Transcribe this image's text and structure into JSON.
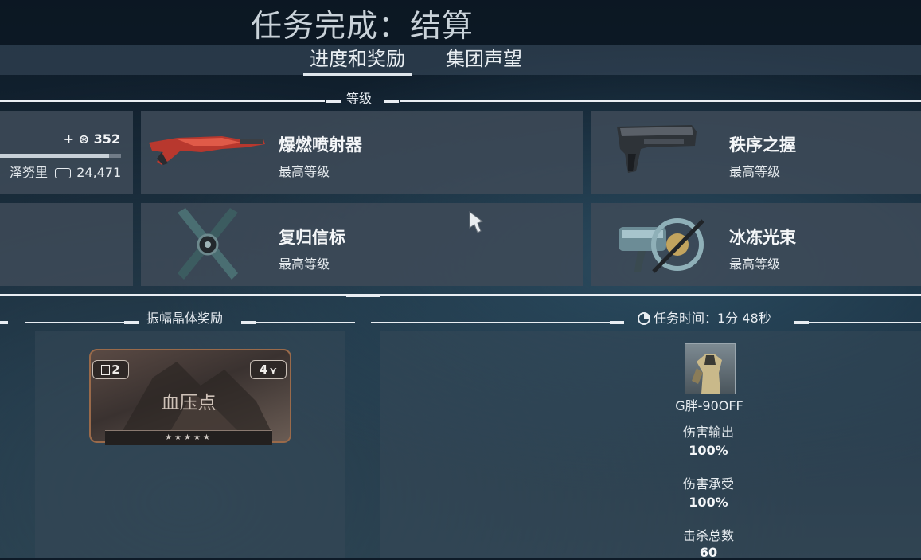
{
  "header": {
    "title": "任务完成：结算",
    "tabs": [
      {
        "label": "进度和奖励",
        "active": true
      },
      {
        "label": "集团声望",
        "active": false
      }
    ]
  },
  "sections": {
    "rank": "等级",
    "relic_reward": "振幅晶体奖励",
    "mission_time": "任务时间：1分 48秒"
  },
  "summary_card": {
    "affinity": "+ ⊛ 352",
    "credits_source": "泽努里",
    "credits": "24,471",
    "progress": 0.9
  },
  "items": [
    {
      "name": "爆燃喷射器",
      "status": "最高等级",
      "icon": "red-rifle-icon"
    },
    {
      "name": "秩序之握",
      "status": "最高等级",
      "icon": "pistol-icon"
    },
    {
      "name": "复归信标",
      "status": "最高等级",
      "icon": "cross-blade-icon"
    },
    {
      "name": "冰冻光束",
      "status": "最高等级",
      "icon": "freeze-gun-icon"
    }
  ],
  "reward_card": {
    "name": "血压点",
    "count": "2",
    "rank": "4",
    "stars": "★★★★★"
  },
  "player": {
    "name": "G胖-90OFF",
    "stats": [
      {
        "label": "伤害输出",
        "value": "100%"
      },
      {
        "label": "伤害承受",
        "value": "100%"
      },
      {
        "label": "击杀总数",
        "value": "60"
      }
    ]
  },
  "colors": {
    "accent": "#e9eef3",
    "card_bg": "#3e4a58"
  }
}
